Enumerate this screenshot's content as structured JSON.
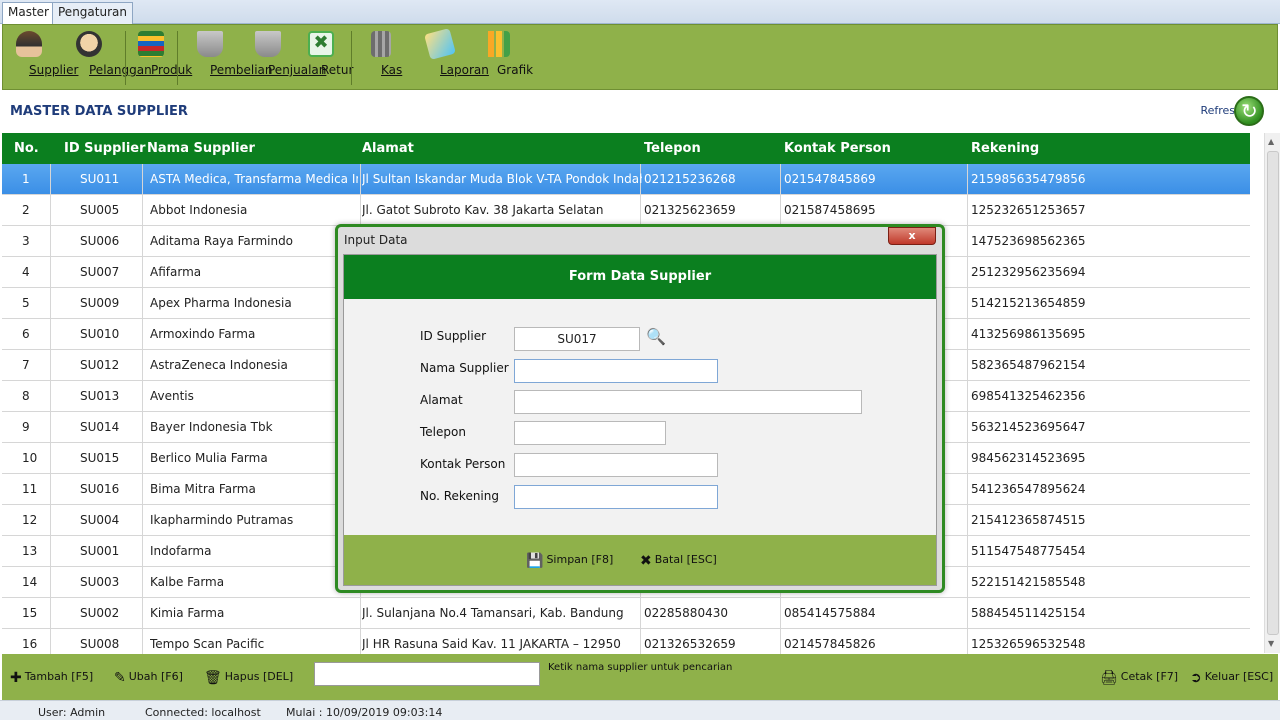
{
  "tabs": [
    "Master",
    "Pengaturan"
  ],
  "ribbon": [
    {
      "label": "Supplier",
      "icon": "supplier-icon"
    },
    {
      "label": "Pelanggan",
      "icon": "customer-icon"
    },
    {
      "label": "Produk",
      "icon": "product-icon"
    },
    {
      "label": "Pembelian",
      "icon": "cart-purchase-icon"
    },
    {
      "label": "Penjualan",
      "icon": "cart-sale-icon"
    },
    {
      "label": "Retur",
      "icon": "return-icon"
    },
    {
      "label": "Kas",
      "icon": "cash-icon"
    },
    {
      "label": "Laporan",
      "icon": "report-icon"
    },
    {
      "label": "Grafik",
      "icon": "chart-icon"
    }
  ],
  "page": {
    "title": "MASTER DATA SUPPLIER",
    "refresh": "Refresh"
  },
  "table": {
    "columns": [
      "No.",
      "ID Supplier",
      "Nama Supplier",
      "Alamat",
      "Telepon",
      "Kontak Person",
      "Rekening"
    ],
    "rows": [
      [
        "1",
        "SU011",
        "ASTA Medica, Transfarma Medica Indah",
        "Jl Sultan Iskandar Muda Blok V-TA Pondok Indah JAKARTA",
        "021215236268",
        "021547845869",
        "215985635479856"
      ],
      [
        "2",
        "SU005",
        "Abbot Indonesia",
        "Jl. Gatot Subroto Kav. 38 Jakarta Selatan",
        "021325623659",
        "021587458695",
        "125232651253657"
      ],
      [
        "3",
        "SU006",
        "Aditama Raya Farmindo",
        "",
        "",
        "",
        "147523698562365"
      ],
      [
        "4",
        "SU007",
        "Afifarma",
        "",
        "",
        "",
        "251232956235694"
      ],
      [
        "5",
        "SU009",
        "Apex Pharma Indonesia",
        "",
        "",
        "",
        "514215213654859"
      ],
      [
        "6",
        "SU010",
        "Armoxindo Farma",
        "",
        "",
        "",
        "413256986135695"
      ],
      [
        "7",
        "SU012",
        "AstraZeneca Indonesia",
        "",
        "",
        "",
        "582365487962154"
      ],
      [
        "8",
        "SU013",
        "Aventis",
        "",
        "",
        "",
        "698541325462356"
      ],
      [
        "9",
        "SU014",
        "Bayer Indonesia Tbk",
        "",
        "",
        "",
        "563214523695647"
      ],
      [
        "10",
        "SU015",
        "Berlico Mulia Farma",
        "",
        "",
        "",
        "984562314523695"
      ],
      [
        "11",
        "SU016",
        "Bima Mitra Farma",
        "",
        "",
        "",
        "541236547895624"
      ],
      [
        "12",
        "SU004",
        "Ikapharmindo Putramas",
        "",
        "",
        "",
        "215412365874515"
      ],
      [
        "13",
        "SU001",
        "Indofarma",
        "",
        "",
        "",
        "511547548775454"
      ],
      [
        "14",
        "SU003",
        "Kalbe Farma",
        "",
        "",
        "",
        "522151421585548"
      ],
      [
        "15",
        "SU002",
        "Kimia Farma",
        "Jl. Sulanjana No.4 Tamansari, Kab. Bandung",
        "02285880430",
        "085414575884",
        "588454511425154"
      ],
      [
        "16",
        "SU008",
        "Tempo Scan Pacific",
        "Jl HR Rasuna Said Kav. 11 JAKARTA – 12950",
        "021326532659",
        "021457845826",
        "125326596532548"
      ]
    ]
  },
  "bottom": {
    "add": "Tambah [F5]",
    "edit": "Ubah [F6]",
    "delete": "Hapus [DEL]",
    "search_value": "",
    "search_hint": "Ketik nama supplier untuk pencarian",
    "print": "Cetak [F7]",
    "exit": "Keluar [ESC]"
  },
  "status": {
    "user": "User: Admin",
    "connected": "Connected: localhost",
    "start": "Mulai : 10/09/2019  09:03:14"
  },
  "dialog": {
    "window_title": "Input Data",
    "close": "x",
    "header": "Form Data Supplier",
    "labels": {
      "id": "ID Supplier",
      "name": "Nama Supplier",
      "address": "Alamat",
      "phone": "Telepon",
      "contact": "Kontak Person",
      "account": "No. Rekening"
    },
    "values": {
      "id": "SU017",
      "name": "",
      "address": "",
      "phone": "",
      "contact": "",
      "account": ""
    },
    "save": "Simpan [F8]",
    "cancel": "Batal [ESC]"
  },
  "colors": {
    "accent_green": "#0b7f1f",
    "ribbon_green": "#8fb14a",
    "selection_blue": "#3b8fe6"
  }
}
